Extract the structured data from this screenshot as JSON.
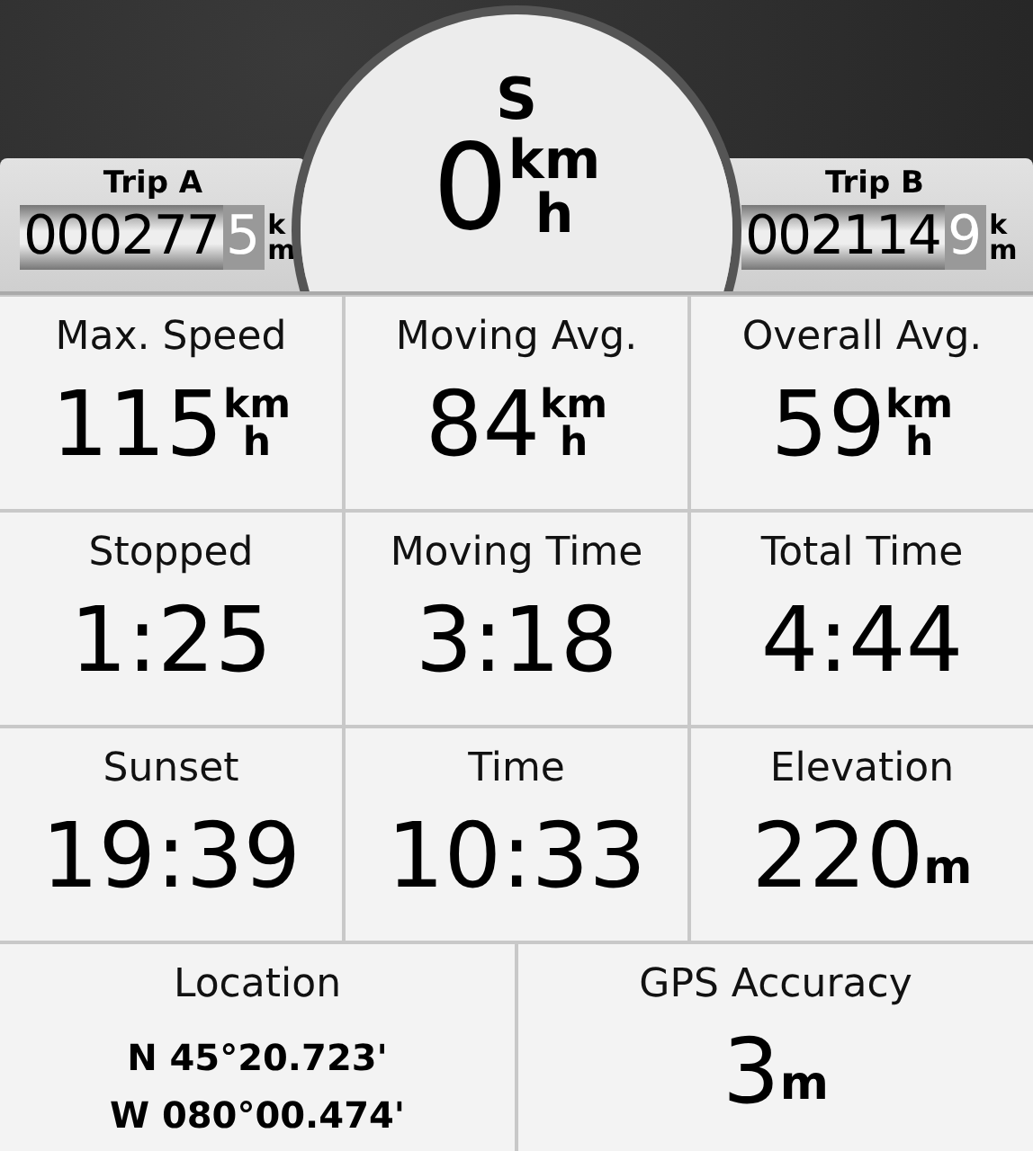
{
  "compass": {
    "heading": "S",
    "speed": "0",
    "unit_top": "km",
    "unit_bottom": "h"
  },
  "trips": [
    {
      "label": "Trip A",
      "reading": "000277",
      "fraction": "5",
      "unit": "km"
    },
    {
      "label": "Trip B",
      "reading": "002114",
      "fraction": "9",
      "unit": "km"
    }
  ],
  "fields": [
    {
      "kind": "speed",
      "label": "Max. Speed",
      "value": "115",
      "unit_top": "km",
      "unit_bottom": "h"
    },
    {
      "kind": "speed",
      "label": "Moving Avg.",
      "value": "84",
      "unit_top": "km",
      "unit_bottom": "h"
    },
    {
      "kind": "speed",
      "label": "Overall Avg.",
      "value": "59",
      "unit_top": "km",
      "unit_bottom": "h"
    },
    {
      "kind": "plain",
      "label": "Stopped",
      "value": "1:25"
    },
    {
      "kind": "plain",
      "label": "Moving Time",
      "value": "3:18"
    },
    {
      "kind": "plain",
      "label": "Total Time",
      "value": "4:44"
    },
    {
      "kind": "plain",
      "label": "Sunset",
      "value": "19:39"
    },
    {
      "kind": "plain",
      "label": "Time",
      "value": "10:33"
    },
    {
      "kind": "unit",
      "label": "Elevation",
      "value": "220",
      "unit": "m"
    },
    {
      "kind": "location",
      "label": "Location",
      "lines": [
        "N 45°20.723'",
        "W 080°00.474'"
      ]
    },
    {
      "kind": "unit",
      "label": "GPS Accuracy",
      "value": "3",
      "unit": "m"
    }
  ]
}
